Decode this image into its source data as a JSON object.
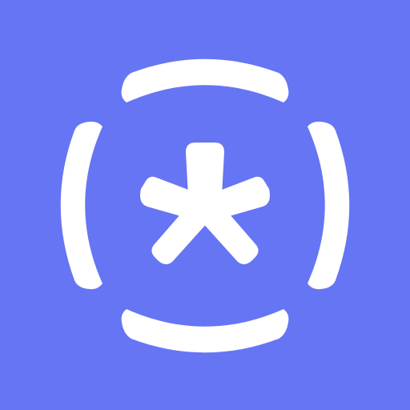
{
  "icon": {
    "name": "asterisk-logo-icon",
    "colors": {
      "background": "#6675F4",
      "foreground": "#FFFFFF"
    }
  }
}
